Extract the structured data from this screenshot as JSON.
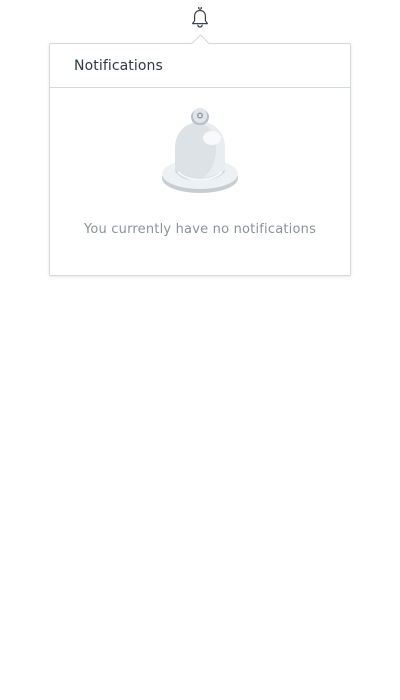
{
  "icons": {
    "trigger": "bell-icon",
    "illustration": "bell-illustration"
  },
  "popover": {
    "title": "Notifications",
    "empty_message": "You currently have no notifications"
  },
  "colors": {
    "border": "#d6d9dc",
    "title_text": "#2d3a45",
    "muted_text": "#8a939b"
  }
}
